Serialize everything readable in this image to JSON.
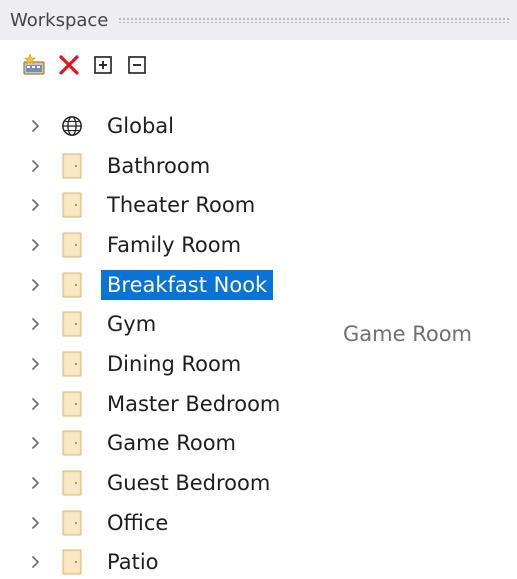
{
  "window": {
    "title": "Workspace"
  },
  "toolbar": {
    "buttons": [
      {
        "icon": "new-item-icon",
        "tooltip": ""
      },
      {
        "icon": "delete-x-icon",
        "tooltip": ""
      },
      {
        "icon": "expand-all-icon",
        "tooltip": ""
      },
      {
        "icon": "collapse-all-icon",
        "tooltip": ""
      }
    ]
  },
  "tree": {
    "items": [
      {
        "label": "Global",
        "icon": "globe-icon",
        "selected": false
      },
      {
        "label": "Bathroom",
        "icon": "door-icon",
        "selected": false
      },
      {
        "label": "Theater Room",
        "icon": "door-icon",
        "selected": false
      },
      {
        "label": "Family Room",
        "icon": "door-icon",
        "selected": false
      },
      {
        "label": "Breakfast Nook",
        "icon": "door-icon",
        "selected": true
      },
      {
        "label": "Gym",
        "icon": "door-icon",
        "selected": false
      },
      {
        "label": "Dining Room",
        "icon": "door-icon",
        "selected": false
      },
      {
        "label": "Master Bedroom",
        "icon": "door-icon",
        "selected": false
      },
      {
        "label": "Game Room",
        "icon": "door-icon",
        "selected": false
      },
      {
        "label": "Guest Bedroom",
        "icon": "door-icon",
        "selected": false
      },
      {
        "label": "Office",
        "icon": "door-icon",
        "selected": false
      },
      {
        "label": "Patio",
        "icon": "door-icon",
        "selected": false
      }
    ]
  },
  "drag_ghost": {
    "label": "Game Room"
  },
  "colors": {
    "selection": "#0a74d6",
    "title_bar": "#eeeef2",
    "door": "#f5deb3"
  }
}
